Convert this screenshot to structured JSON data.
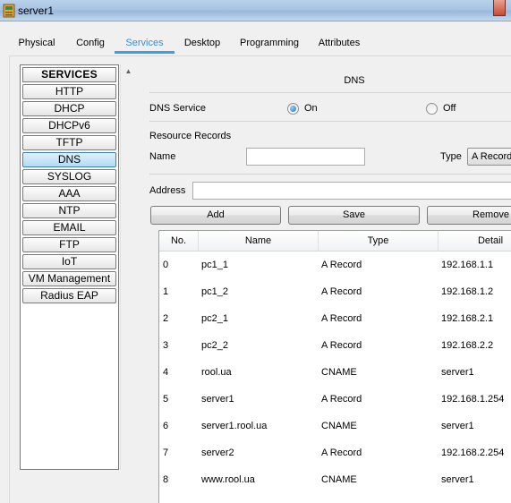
{
  "window": {
    "title": "server1"
  },
  "tabs": [
    {
      "label": "Physical"
    },
    {
      "label": "Config"
    },
    {
      "label": "Services"
    },
    {
      "label": "Desktop"
    },
    {
      "label": "Programming"
    },
    {
      "label": "Attributes"
    }
  ],
  "active_tab": "Services",
  "services": {
    "header": "SERVICES",
    "items": [
      "HTTP",
      "DHCP",
      "DHCPv6",
      "TFTP",
      "DNS",
      "SYSLOG",
      "AAA",
      "NTP",
      "EMAIL",
      "FTP",
      "IoT",
      "VM Management",
      "Radius EAP"
    ],
    "selected": "DNS"
  },
  "dns": {
    "title": "DNS",
    "service_label": "DNS Service",
    "on_label": "On",
    "off_label": "Off",
    "service_state": "On",
    "resource_records_label": "Resource Records",
    "name_label": "Name",
    "name_value": "",
    "type_label": "Type",
    "type_value": "A Record",
    "address_label": "Address",
    "address_value": "",
    "add_label": "Add",
    "save_label": "Save",
    "remove_label": "Remove"
  },
  "table": {
    "columns": [
      "No.",
      "Name",
      "Type",
      "Detail"
    ],
    "rows": [
      {
        "no": "0",
        "name": "pc1_1",
        "type": "A Record",
        "detail": "192.168.1.1"
      },
      {
        "no": "1",
        "name": "pc1_2",
        "type": "A Record",
        "detail": "192.168.1.2"
      },
      {
        "no": "2",
        "name": "pc2_1",
        "type": "A Record",
        "detail": "192.168.2.1"
      },
      {
        "no": "3",
        "name": "pc2_2",
        "type": "A Record",
        "detail": "192.168.2.2"
      },
      {
        "no": "4",
        "name": "rool.ua",
        "type": "CNAME",
        "detail": "server1"
      },
      {
        "no": "5",
        "name": "server1",
        "type": "A Record",
        "detail": "192.168.1.254"
      },
      {
        "no": "6",
        "name": "server1.rool.ua",
        "type": "CNAME",
        "detail": "server1"
      },
      {
        "no": "7",
        "name": "server2",
        "type": "A Record",
        "detail": "192.168.2.254"
      },
      {
        "no": "8",
        "name": "www.rool.ua",
        "type": "CNAME",
        "detail": "server1"
      }
    ]
  },
  "colors": {
    "accent": "#3aa0e8",
    "selected_service": "#b4dbf5"
  }
}
